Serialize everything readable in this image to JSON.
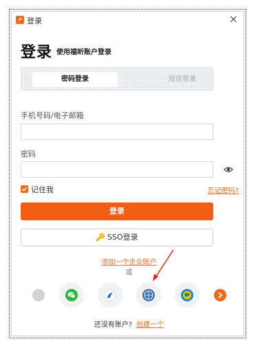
{
  "window": {
    "title": "登录",
    "close_label": "×"
  },
  "heading": {
    "title": "登录",
    "subtitle": "使用福昕账户登录"
  },
  "tabs": [
    {
      "label": "密码登录",
      "active": true
    },
    {
      "label": "短信登录",
      "active": false
    }
  ],
  "fields": {
    "account": {
      "label": "手机号码/电子邮箱",
      "value": "",
      "placeholder": ""
    },
    "password": {
      "label": "密码",
      "value": "",
      "placeholder": ""
    }
  },
  "remember": {
    "label": "记住我",
    "checked": true
  },
  "forgot_label": "忘记密码?",
  "login_button": "登录",
  "sso_button": "SSO登录",
  "enterprise_link": "添加一个企业账户",
  "or_text": "或",
  "third_party": [
    {
      "name": "scroll-left-icon"
    },
    {
      "name": "wechat-icon"
    },
    {
      "name": "feishu-icon"
    },
    {
      "name": "carsi-icon"
    },
    {
      "name": "globe-network-icon"
    },
    {
      "name": "scroll-right-icon"
    }
  ],
  "signup": {
    "question": "还没有账户?",
    "link": "创建一个"
  },
  "colors": {
    "accent": "#f26a1b",
    "button": "#f35c13",
    "annotation_arrow": "#e0281b"
  }
}
